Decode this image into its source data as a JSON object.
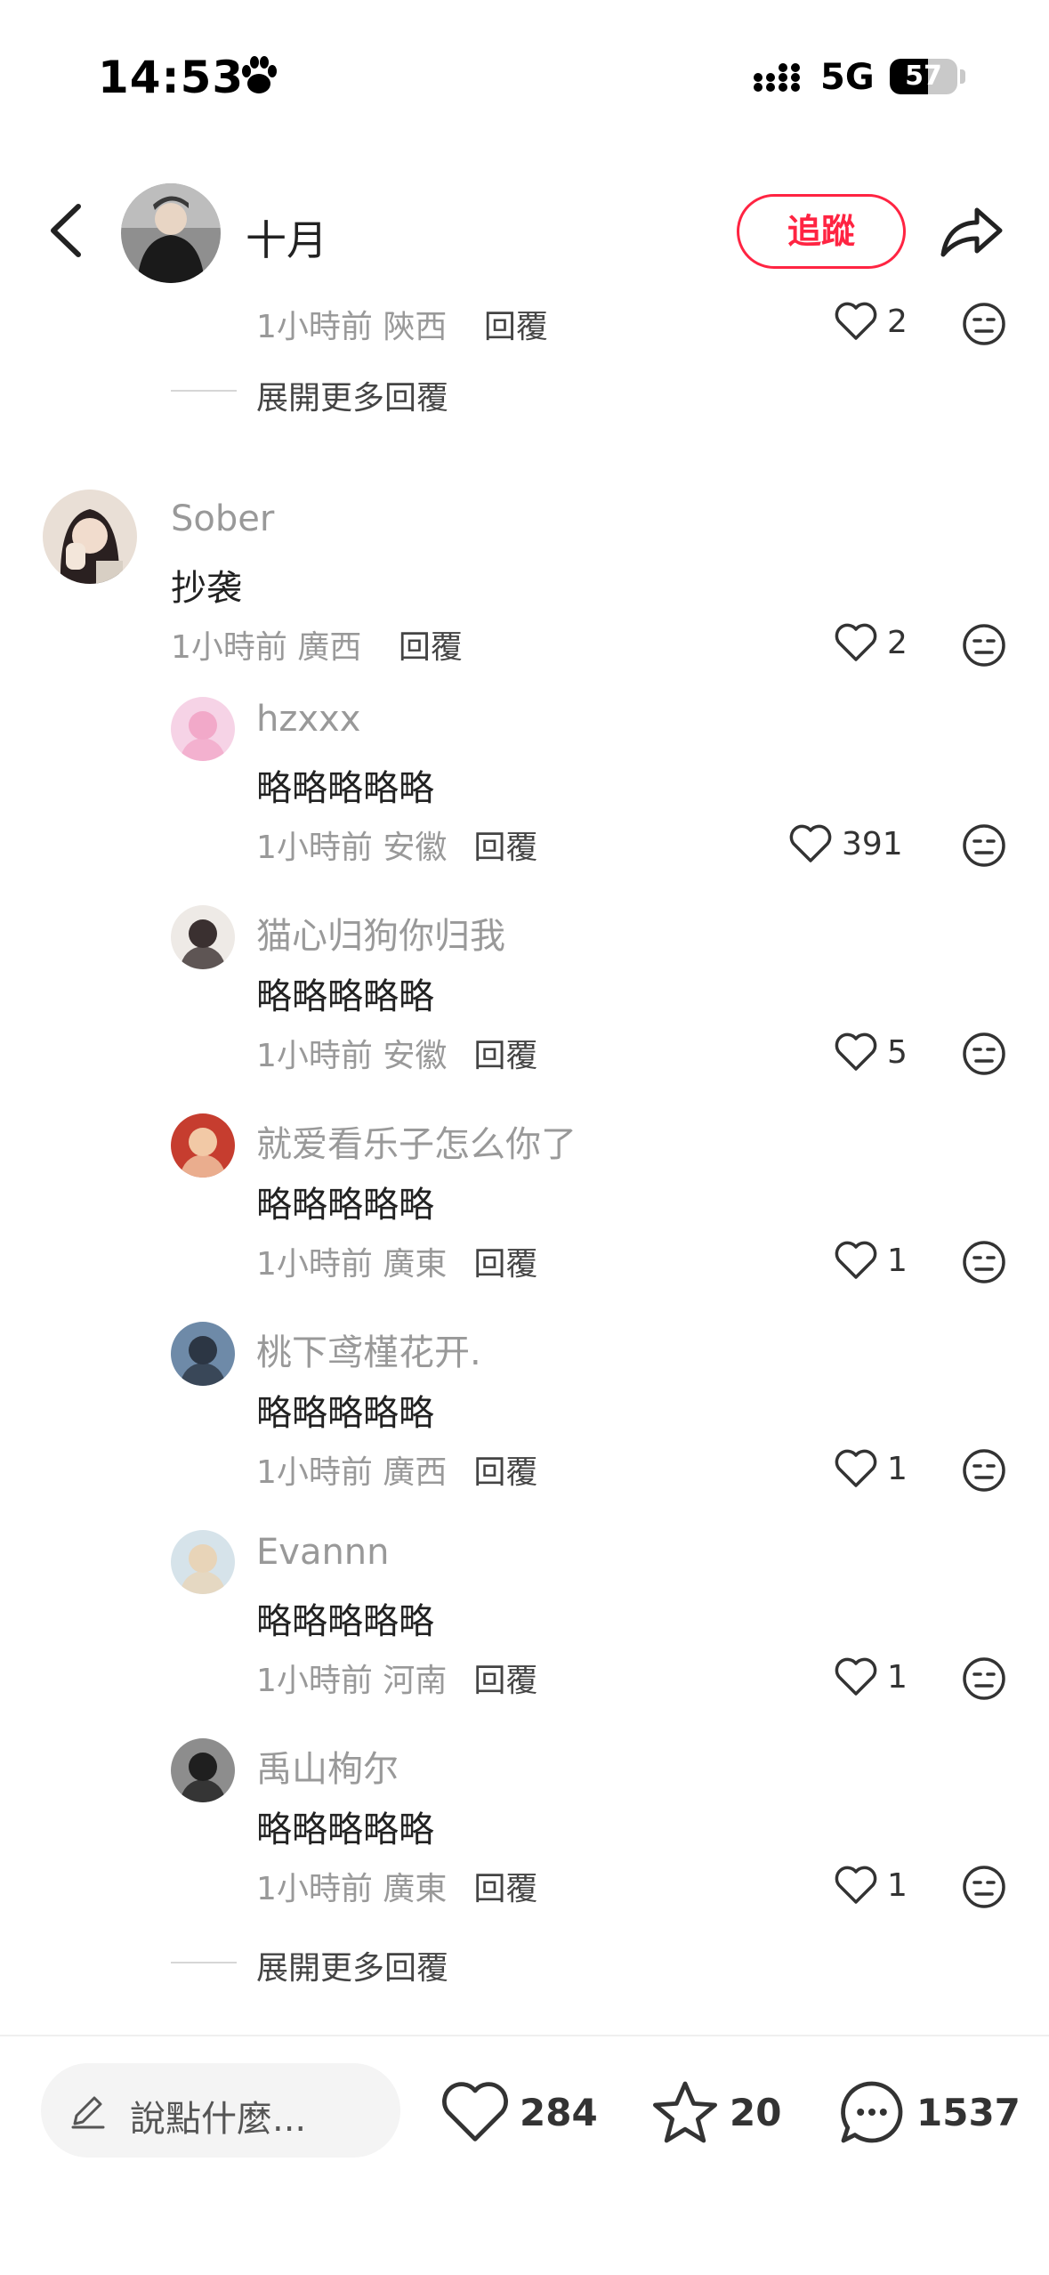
{
  "status_bar": {
    "time": "14:53",
    "network": "5G",
    "battery": 57,
    "icons": [
      "paw-icon",
      "signal-icon",
      "battery-icon"
    ]
  },
  "header": {
    "author_name": "十月",
    "follow_label": "追蹤",
    "icons": [
      "back-icon",
      "share-icon"
    ]
  },
  "comments": {
    "prev_reply_meta": {
      "time": "1小時前",
      "location": "陝西",
      "reply": "回覆",
      "likes": "2"
    },
    "expand_more_top": "展開更多回覆",
    "main": {
      "username": "Sober",
      "text": "抄袭",
      "time": "1小時前",
      "location": "廣西",
      "reply": "回覆",
      "likes": "2"
    },
    "replies": [
      {
        "username": "hzxxx",
        "text": "略略略略略",
        "time": "1小時前",
        "location": "安徽",
        "reply": "回覆",
        "likes": "391"
      },
      {
        "username": "猫心归狗你归我",
        "text": "略略略略略",
        "time": "1小時前",
        "location": "安徽",
        "reply": "回覆",
        "likes": "5"
      },
      {
        "username": "就爱看乐子怎么你了",
        "text": "略略略略略",
        "time": "1小時前",
        "location": "廣東",
        "reply": "回覆",
        "likes": "1"
      },
      {
        "username": "桃下鸢槿花开.",
        "text": "略略略略略",
        "time": "1小時前",
        "location": "廣西",
        "reply": "回覆",
        "likes": "1"
      },
      {
        "username": "Evannn",
        "text": "略略略略略",
        "time": "1小時前",
        "location": "河南",
        "reply": "回覆",
        "likes": "1"
      },
      {
        "username": "禹山栒尔",
        "text": "略略略略略",
        "time": "1小時前",
        "location": "廣東",
        "reply": "回覆",
        "likes": "1"
      }
    ],
    "expand_more_bottom": "展開更多回覆"
  },
  "bottom_bar": {
    "input_placeholder": "說點什麼...",
    "likes": "284",
    "collects": "20",
    "comments": "1537",
    "icons": [
      "pencil-icon",
      "heart-icon",
      "star-icon",
      "comment-icon"
    ]
  },
  "colors": {
    "accent": "#ff2442",
    "muted": "#999999",
    "text": "#222222"
  }
}
